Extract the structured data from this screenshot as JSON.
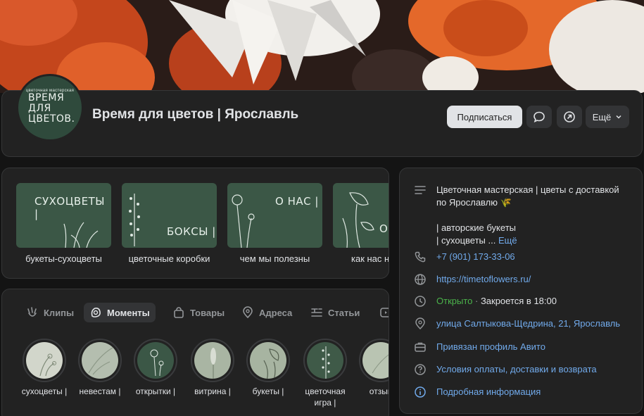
{
  "page": {
    "title": "Время для цветов | Ярославль",
    "avatar_text": {
      "small": "цветочная мастерская",
      "line1": "ВРЕМЯ",
      "line2": "ДЛЯ",
      "line3": "ЦВЕТОВ."
    }
  },
  "actions": {
    "subscribe_label": "Подписаться",
    "more_label": "Ещё"
  },
  "collections": [
    {
      "label": "букеты-сухоцветы",
      "thumb_text": "СУХОЦВЕТЫ |"
    },
    {
      "label": "цветочные коробки",
      "thumb_text": "БОКСЫ |"
    },
    {
      "label": "чем мы полезны",
      "thumb_text": "О НАС |"
    },
    {
      "label": "как нас н",
      "thumb_text": "О"
    }
  ],
  "tabs": [
    {
      "label": "Клипы",
      "icon": "clips-icon"
    },
    {
      "label": "Моменты",
      "icon": "moments-icon",
      "active": true
    },
    {
      "label": "Товары",
      "icon": "bag-icon"
    },
    {
      "label": "Адреса",
      "icon": "pin-icon"
    },
    {
      "label": "Статьи",
      "icon": "articles-icon"
    }
  ],
  "stories": [
    {
      "label1": "сухоцветы |",
      "label2": ""
    },
    {
      "label1": "невестам |",
      "label2": ""
    },
    {
      "label1": "открытки |",
      "label2": ""
    },
    {
      "label1": "витрина |",
      "label2": ""
    },
    {
      "label1": "букеты |",
      "label2": ""
    },
    {
      "label1": "цветочная",
      "label2": "игра |"
    },
    {
      "label1": "отзыв",
      "label2": ""
    }
  ],
  "info": {
    "description_line1": "Цветочная мастерская | цветы с доставкой",
    "description_line2": "по Ярославлю 🌾",
    "description_line3": "| авторские букеты",
    "description_line4": "| сухоцветы ...",
    "description_more": "Ещё",
    "phone": "+7 (901) 173-33-06",
    "website": "https://timetoflowers.ru/",
    "status_open": "Открыто",
    "status_sep": " · ",
    "status_close": "Закроется в 18:00",
    "address": "улица Салтыкова-Щедрина, 21, Ярославль",
    "avito": "Привязан профиль Авито",
    "terms": "Условия оплаты, доставки и возврата",
    "details": "Подробная информация"
  },
  "colors": {
    "accent_link": "#71aaeb",
    "open_green": "#4bb34b",
    "thumb_green": "#3b5746"
  }
}
